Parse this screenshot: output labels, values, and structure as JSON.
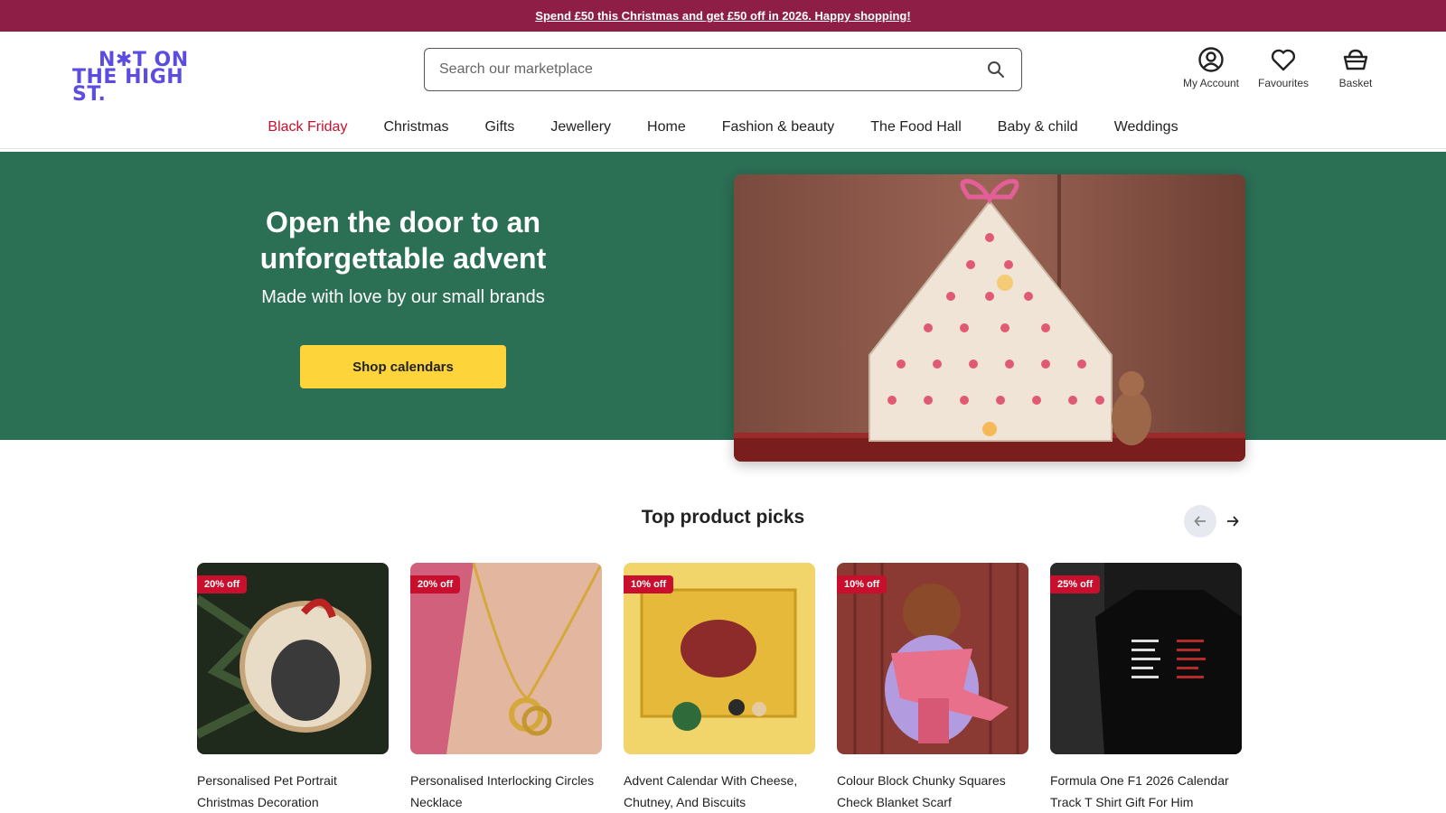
{
  "promo": {
    "text": "Spend £50 this Christmas and get £50 off in 2026. Happy shopping!"
  },
  "logo": {
    "line1": "N✱T ON",
    "line2": "THE HIGH ST."
  },
  "search": {
    "placeholder": "Search our marketplace"
  },
  "header_actions": [
    {
      "label": "My Account",
      "icon": "account-icon"
    },
    {
      "label": "Favourites",
      "icon": "heart-icon"
    },
    {
      "label": "Basket",
      "icon": "basket-icon"
    }
  ],
  "nav": [
    {
      "label": "Black Friday"
    },
    {
      "label": "Christmas"
    },
    {
      "label": "Gifts"
    },
    {
      "label": "Jewellery"
    },
    {
      "label": "Home"
    },
    {
      "label": "Fashion & beauty"
    },
    {
      "label": "The Food Hall"
    },
    {
      "label": "Baby & child"
    },
    {
      "label": "Weddings"
    }
  ],
  "hero": {
    "title": "Open the door to an unforgettable advent",
    "subtitle": "Made with love by our small brands",
    "cta": "Shop calendars"
  },
  "picks": {
    "title": "Top product picks",
    "products": [
      {
        "badge": "20% off",
        "name": "Personalised Pet Portrait Christmas Decoration"
      },
      {
        "badge": "20% off",
        "name": "Personalised Interlocking Circles Necklace"
      },
      {
        "badge": "10% off",
        "name": "Advent Calendar With Cheese, Chutney, And Biscuits"
      },
      {
        "badge": "10% off",
        "name": "Colour Block Chunky Squares Check Blanket Scarf"
      },
      {
        "badge": "25% off",
        "name": "Formula One F1 2026 Calendar Track T Shirt Gift For Him"
      }
    ]
  },
  "colors": {
    "promo_bg": "#8e1e45",
    "brand": "#5c4de0",
    "hero_bg": "#2b6f55",
    "cta_bg": "#fdd43a",
    "sale": "#c8102e"
  }
}
